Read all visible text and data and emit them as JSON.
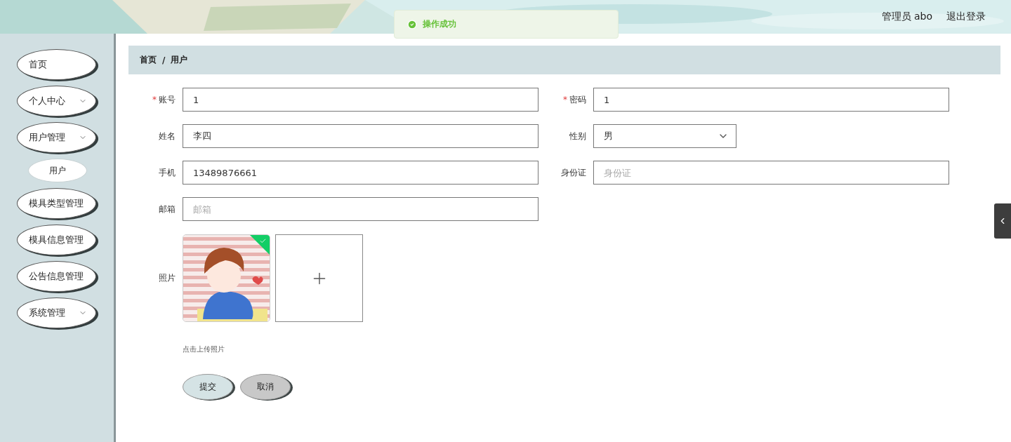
{
  "header": {
    "user": "管理员 abo",
    "logout": "退出登录",
    "background": {
      "kind": "picture"
    }
  },
  "toast": {
    "message": "操作成功"
  },
  "sidebar": {
    "items": [
      {
        "label": "首页",
        "expandable": false
      },
      {
        "label": "个人中心",
        "expandable": true
      },
      {
        "label": "用户管理",
        "expandable": true,
        "children": [
          {
            "label": "用户"
          }
        ]
      },
      {
        "label": "模具类型管理",
        "expandable": false
      },
      {
        "label": "模具信息管理",
        "expandable": false
      },
      {
        "label": "公告信息管理",
        "expandable": false
      },
      {
        "label": "系统管理",
        "expandable": true
      }
    ]
  },
  "breadcrumb": {
    "separator": "/",
    "items": [
      "首页",
      "用户"
    ]
  },
  "form": {
    "required_mark": "*",
    "fields": [
      {
        "label": "账号",
        "required": true,
        "kind": "input",
        "value": "1"
      },
      {
        "label": "密码",
        "required": true,
        "kind": "input",
        "value": "1"
      },
      {
        "label": "姓名",
        "required": false,
        "kind": "input",
        "value": "李四"
      },
      {
        "label": "性别",
        "required": false,
        "kind": "select",
        "value": "男"
      },
      {
        "label": "手机",
        "required": false,
        "kind": "input",
        "value": "13489876661"
      },
      {
        "label": "身份证",
        "required": false,
        "kind": "input",
        "placeholder": "身份证"
      },
      {
        "label": "邮箱",
        "required": false,
        "kind": "input",
        "placeholder": "邮箱"
      }
    ],
    "photo": {
      "label": "照片",
      "uploaded": [
        {
          "kind": "picture",
          "success": true
        }
      ],
      "hint": "点击上传照片"
    },
    "buttons": [
      {
        "label": "提交",
        "kind": "primary"
      },
      {
        "label": "取消",
        "kind": "secondary"
      }
    ]
  },
  "side_tab": {
    "kind": "collapse"
  }
}
